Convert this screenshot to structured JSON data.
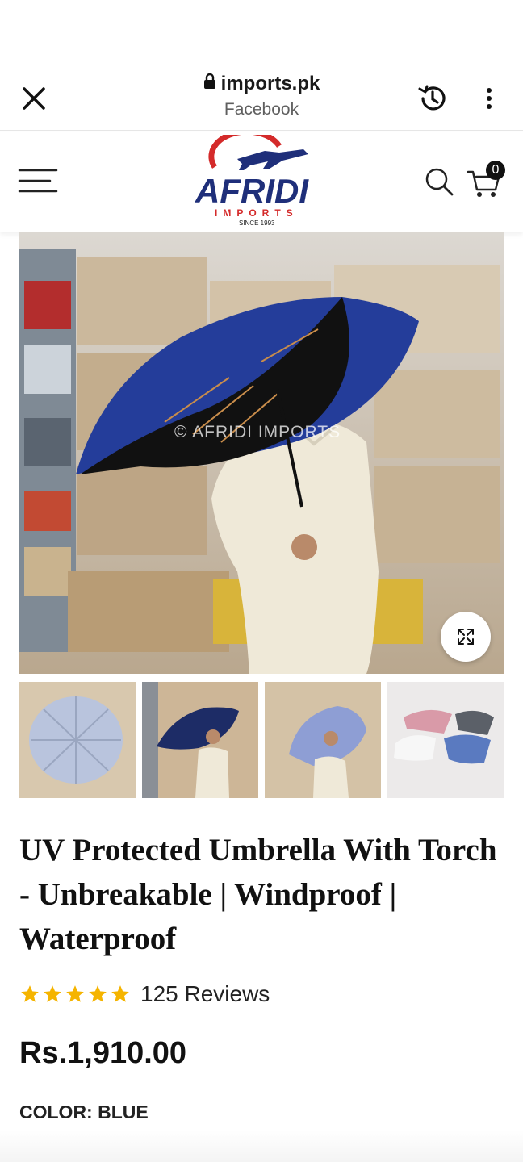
{
  "browser": {
    "url": "imports.pk",
    "source": "Facebook"
  },
  "header": {
    "logo_name": "AFRIDI",
    "logo_tagline": "IMPORTS",
    "logo_since": "SINCE 1993",
    "cart_count": "0"
  },
  "gallery": {
    "watermark": "© AFRIDI IMPORTS",
    "thumbnails": [
      "thumb-umbrella-open",
      "thumb-man-umbrella",
      "thumb-man-blue-umbrella",
      "thumb-folded-umbrellas"
    ]
  },
  "product": {
    "title": "UV Protected Umbrella With Torch - Unbreakable | Windproof | Waterproof",
    "rating": 5,
    "reviews_label": "125 Reviews",
    "price": "Rs.1,910.00",
    "color_label": "COLOR: BLUE"
  },
  "colors": {
    "brand_red": "#d42a2a",
    "brand_navy": "#1f2f7a",
    "star": "#f5b400"
  }
}
